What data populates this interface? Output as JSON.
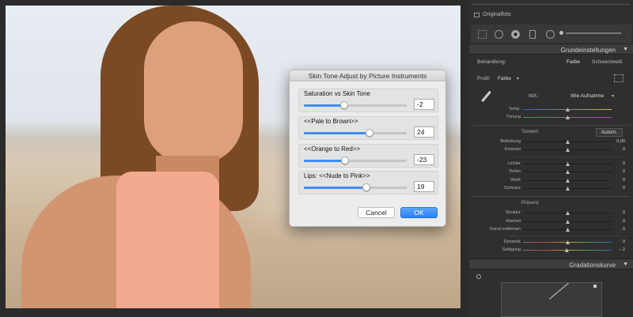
{
  "dialog": {
    "title": "Skin Tone Adjust by Picture Instruments",
    "sliders": [
      {
        "label": "Saturation vs Skin Tone",
        "value": "-2",
        "fraction": 0.39
      },
      {
        "label": "<<Pale  to  Brown>>",
        "value": "24",
        "fraction": 0.64
      },
      {
        "label": "<<Orange  to  Red>>",
        "value": "-23",
        "fraction": 0.4
      },
      {
        "label": "Lips: <<Nude to Pink>>",
        "value": "19",
        "fraction": 0.61
      }
    ],
    "cancel_label": "Cancel",
    "ok_label": "OK"
  },
  "panel": {
    "original_label": "Originalfoto",
    "section_title": "Grundeinstellungen",
    "treatment_label": "Behandlung:",
    "treatment_color": "Farbe",
    "treatment_bw": "Schwarzweiß",
    "profile_label": "Profil:",
    "profile_value": "Farbe",
    "wb_label": "WA:",
    "wb_value": "Wie Aufnahme",
    "temp_label": "Temp.",
    "tint_label": "Tönung",
    "tone_title": "Tonwert",
    "auto_label": "Autom.",
    "tone_rows": [
      {
        "label": "Belichtung",
        "value": "0,00"
      },
      {
        "label": "Kontrast",
        "value": "0"
      },
      {
        "label": "Lichter",
        "value": "0"
      },
      {
        "label": "Tiefen",
        "value": "0"
      },
      {
        "label": "Weiß",
        "value": "0"
      },
      {
        "label": "Schwarz",
        "value": "0"
      }
    ],
    "presence_title": "Präsenz",
    "presence_rows": [
      {
        "label": "Struktur",
        "value": "0"
      },
      {
        "label": "Klarheit",
        "value": "0"
      },
      {
        "label": "Dunst entfernen",
        "value": "0"
      },
      {
        "label": "Dynamik",
        "value": "0"
      },
      {
        "label": "Sättigung",
        "value": "– 2"
      }
    ],
    "curve_title": "Gradationskurve"
  },
  "colors": {
    "accent": "#3f8cf4",
    "panel_bg": "#2f2f2f"
  }
}
